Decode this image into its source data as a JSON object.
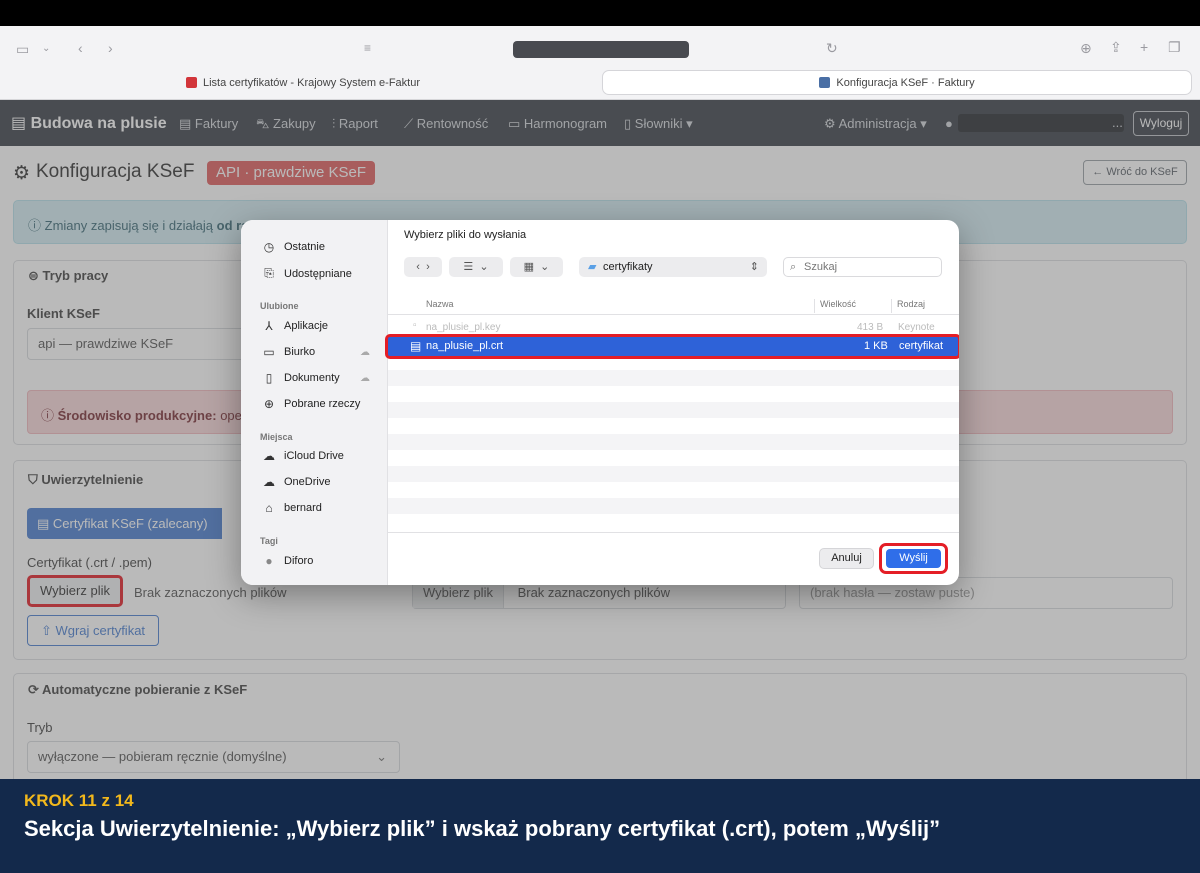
{
  "browser": {
    "tabs": [
      {
        "label": "Lista certyfikatów - Krajowy System e-Faktur"
      },
      {
        "label": "Konfiguracja KSeF · Faktury"
      }
    ]
  },
  "navbar": {
    "brand": "Budowa na plusie",
    "items": [
      "Faktury",
      "Zakupy",
      "Raport",
      "Rentowność",
      "Harmonogram",
      "Słowniki"
    ],
    "admin": "Administracja",
    "user_suffix": "...",
    "logout": "Wyloguj"
  },
  "page": {
    "title": "Konfiguracja KSeF",
    "badge": "API · prawdziwe KSeF",
    "back": "← Wróć do KSeF",
    "info_prefix": "Zmiany zapisują się i działają",
    "info_bold": "od razu"
  },
  "mode": {
    "heading": "Tryb pracy",
    "client_label": "Klient KSeF",
    "client_value": "api — prawdziwe KSeF",
    "alert_bold": "Środowisko produkcyjne:",
    "alert_text": "oper"
  },
  "auth": {
    "heading": "Uwierzytelnienie",
    "tab_label": "Certyfikat KSeF (zalecany)",
    "cert_label": "Certyfikat (.crt / .pem)",
    "choose_file": "Wybierz plik",
    "no_file": "Brak zaznaczonych plików",
    "choose_file2": "Wybierz plik",
    "no_file2": "Brak zaznaczonych plików",
    "password_placeholder": "(brak hasła — zostaw puste)",
    "upload": "Wgraj certyfikat"
  },
  "auto": {
    "heading": "Automatyczne pobieranie z KSeF",
    "mode_label": "Tryb",
    "mode_value": "wyłączone — pobieram ręcznie (domyślne)"
  },
  "dialog": {
    "title": "Wybierz pliki do wysłania",
    "folder": "certyfikaty",
    "search_placeholder": "Szukaj",
    "sidebar": {
      "recents": "Ostatnie",
      "shared": "Udostępniane",
      "favorites_head": "Ulubione",
      "apps": "Aplikacje",
      "desktop": "Biurko",
      "documents": "Dokumenty",
      "downloads": "Pobrane rzeczy",
      "locations_head": "Miejsca",
      "icloud": "iCloud Drive",
      "onedrive": "OneDrive",
      "home": "bernard",
      "tags_head": "Tagi",
      "tag1": "Diforo"
    },
    "columns": {
      "name": "Nazwa",
      "size": "Wielkość",
      "kind": "Rodzaj"
    },
    "files": [
      {
        "name": "na_plusie_pl.key",
        "size": "413 B",
        "kind": "Keynote"
      },
      {
        "name": "na_plusie_pl.crt",
        "size": "1 KB",
        "kind": "certyfikat"
      }
    ],
    "cancel": "Anuluj",
    "send": "Wyślij"
  },
  "footer": {
    "step": "KROK 11 z 14",
    "caption": "Sekcja Uwierzytelnienie: „Wybierz plik” i wskaż pobrany certyfikat (.crt), potem „Wyślij”"
  },
  "colors": {
    "accent": "#2e62d8",
    "highlight": "#e41e26",
    "footer_bg": "#13294b",
    "step": "#f2b81c"
  }
}
